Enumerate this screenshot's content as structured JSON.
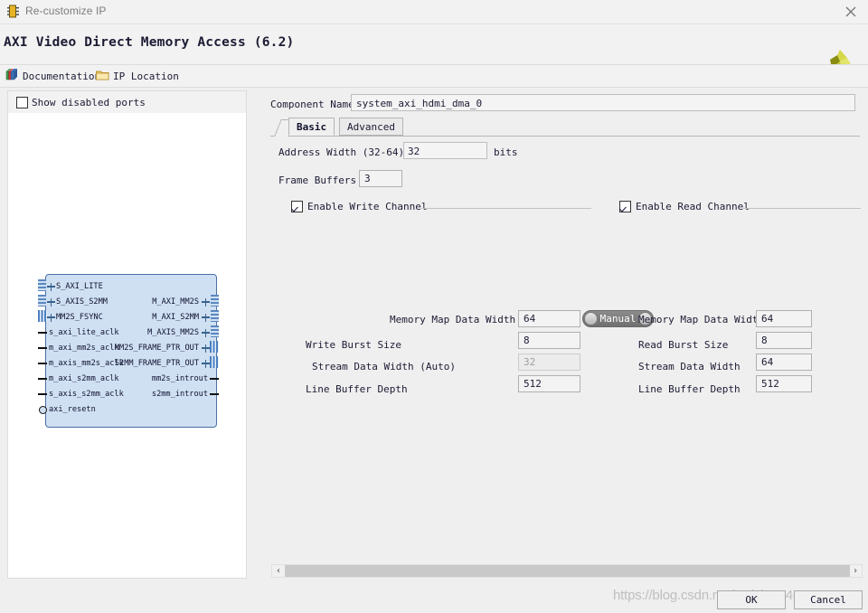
{
  "window": {
    "title": "Re-customize IP",
    "close_label": "✕",
    "icon": "ip-customize-icon"
  },
  "header": {
    "ip_title": "AXI Video Direct Memory Access (6.2)",
    "logo": "xilinx-logo"
  },
  "links": [
    {
      "label": "Documentation",
      "icon": "documentation-book-icon"
    },
    {
      "label": "IP Location",
      "icon": "folder-icon"
    }
  ],
  "left_panel": {
    "show_disabled_ports": {
      "label": "Show disabled ports",
      "checked": false
    },
    "diagram": {
      "left_ports": [
        {
          "name": "S_AXI_LITE",
          "kind": "bus"
        },
        {
          "name": "S_AXIS_S2MM",
          "kind": "bus"
        },
        {
          "name": "MM2S_FSYNC",
          "kind": "bus"
        },
        {
          "name": "s_axi_lite_aclk",
          "kind": "pin"
        },
        {
          "name": "m_axi_mm2s_aclk",
          "kind": "pin"
        },
        {
          "name": "m_axis_mm2s_aclk",
          "kind": "pin"
        },
        {
          "name": "m_axi_s2mm_aclk",
          "kind": "pin"
        },
        {
          "name": "s_axis_s2mm_aclk",
          "kind": "pin"
        },
        {
          "name": "axi_resetn",
          "kind": "pin-inverted"
        }
      ],
      "right_ports": [
        {
          "name": "M_AXI_MM2S",
          "kind": "bus"
        },
        {
          "name": "M_AXI_S2MM",
          "kind": "bus"
        },
        {
          "name": "M_AXIS_MM2S",
          "kind": "bus"
        },
        {
          "name": "MM2S_FRAME_PTR_OUT",
          "kind": "bus"
        },
        {
          "name": "S2MM_FRAME_PTR_OUT",
          "kind": "bus"
        },
        {
          "name": "mm2s_introut",
          "kind": "pin"
        },
        {
          "name": "s2mm_introut",
          "kind": "pin"
        }
      ]
    }
  },
  "right_panel": {
    "component_name": {
      "label": "Component Name",
      "value": "system_axi_hdmi_dma_0",
      "placeholder": ""
    },
    "tabs": [
      {
        "label": "Basic",
        "active": true
      },
      {
        "label": "Advanced",
        "active": false
      }
    ],
    "address_width": {
      "label": "Address Width (32-64)",
      "value": "32",
      "unit": "bits"
    },
    "frame_buffers": {
      "label": "Frame Buffers",
      "value": "3"
    },
    "write_channel": {
      "group_label": "Enable Write Channel",
      "checked": true,
      "manual_toggle": {
        "label": "Manual",
        "state": "manual"
      },
      "rows": [
        {
          "label": "Memory Map Data Width",
          "value": "64",
          "disabled": false
        },
        {
          "label": "Write Burst Size",
          "value": "8",
          "disabled": false
        },
        {
          "label": "Stream Data Width (Auto)",
          "value": "32",
          "disabled": true
        },
        {
          "label": "Line Buffer Depth",
          "value": "512",
          "disabled": false
        }
      ]
    },
    "read_channel": {
      "group_label": "Enable Read Channel",
      "checked": true,
      "rows": [
        {
          "label": "Memory Map Data Width",
          "value": "64",
          "disabled": false
        },
        {
          "label": "Read Burst Size",
          "value": "8",
          "disabled": false
        },
        {
          "label": "Stream Data Width",
          "value": "64",
          "disabled": false
        },
        {
          "label": "Line Buffer Depth",
          "value": "512",
          "disabled": false
        }
      ]
    },
    "scrollbar": {
      "left_arrow": "‹",
      "right_arrow": "›"
    }
  },
  "footer": {
    "ok_label": "OK",
    "cancel_label": "Cancel",
    "watermark": "https://blog.csdn.net/weixin_44630490"
  },
  "colors": {
    "window_bg": "#efefef",
    "panel_bg": "#f2f2f2",
    "block_fill": "#cfe0f2",
    "block_border": "#4a6fa5",
    "logo_light": "#d6d84a",
    "logo_dark": "#8a8c12"
  }
}
